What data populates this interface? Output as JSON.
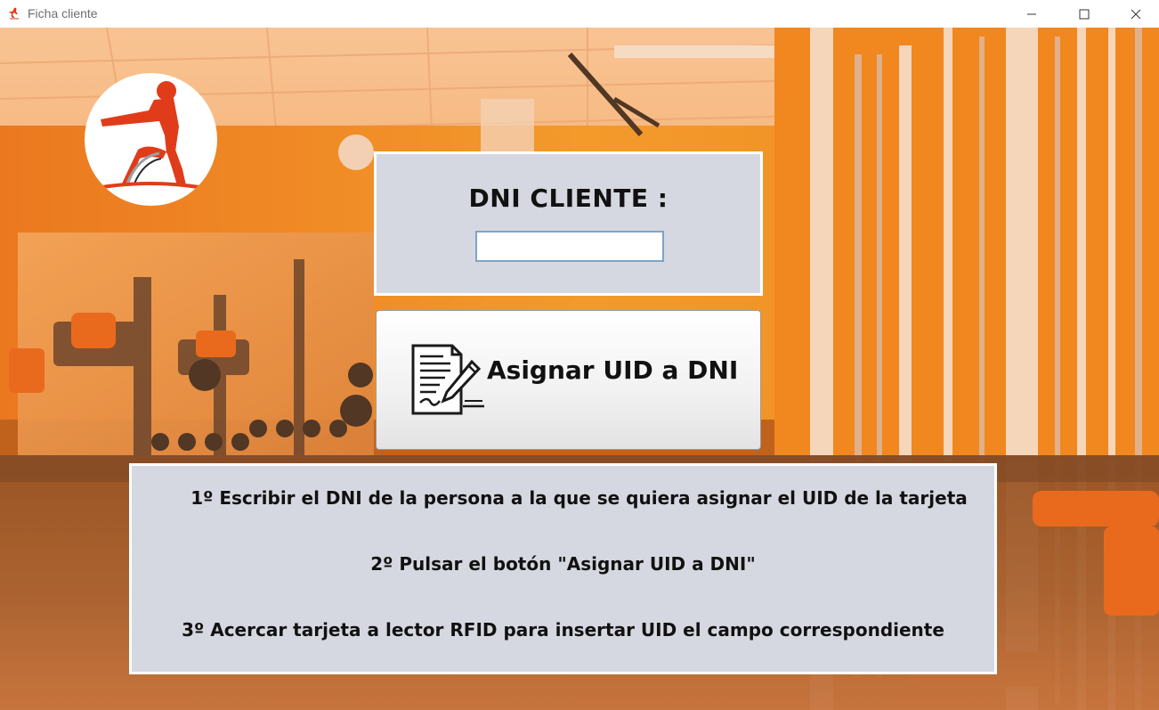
{
  "window": {
    "title": "Ficha cliente"
  },
  "dni": {
    "label": "DNI CLIENTE :",
    "value": "",
    "placeholder": ""
  },
  "assign_button": {
    "label": "Asignar UID a DNI",
    "icon": "contract-sign-icon"
  },
  "instructions": {
    "steps": [
      "1º Escribir el DNI de la persona a la que se quiera asignar el UID de la tarjeta",
      "2º Pulsar el botón \"Asignar UID a DNI\"",
      "3º Acercar tarjeta a lector RFID para insertar UID el campo correspondiente"
    ]
  },
  "colors": {
    "panel_bg": "#d6d8e1",
    "panel_border": "#ffffff",
    "wall_orange": "#f08a1c",
    "logo_figure": "#e03c1a"
  }
}
